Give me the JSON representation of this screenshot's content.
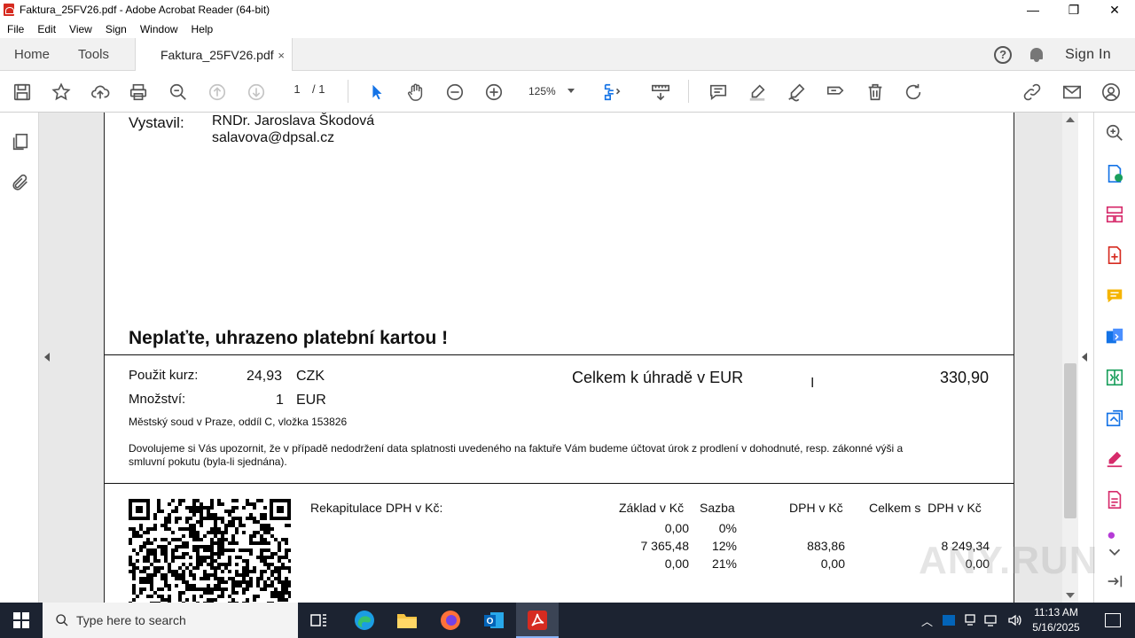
{
  "window": {
    "title": "Faktura_25FV26.pdf - Adobe Acrobat Reader (64-bit)",
    "minimize": "—",
    "maximize": "❐",
    "close": "✕"
  },
  "menu": [
    "File",
    "Edit",
    "View",
    "Sign",
    "Window",
    "Help"
  ],
  "tabs": {
    "home": "Home",
    "tools": "Tools",
    "document": "Faktura_25FV26.pdf",
    "close": "×",
    "sign_in": "Sign In"
  },
  "toolbar": {
    "page_current": "1",
    "page_total": "/ 1",
    "zoom": "125%"
  },
  "document": {
    "issuer_label": "Vystavil:",
    "issuer_name": "RNDr. Jaroslava Škodová",
    "issuer_email": "salavova@dpsal.cz",
    "paid_notice": "Neplaťte, uhrazeno platební kartou !",
    "rate_label": "Použit kurz:",
    "rate_value": "24,93",
    "rate_currency": "CZK",
    "qty_label": "Množství:",
    "qty_value": "1",
    "qty_currency": "EUR",
    "total_label": "Celkem k úhradě v EUR",
    "total_value": "330,90",
    "court": "Městský soud v Praze, oddíl C, vložka 153826",
    "notice_line1": "Dovolujeme si Vás upozornit, že v případě nedodržení data splatnosti uvedeného na faktuře Vám budeme účtovat úrok z prodlení v dohodnuté, resp. zákonné výši a",
    "notice_line2": "smluvní pokutu (byla-li sjednána).",
    "vat_title": "Rekapitulace DPH v Kč:",
    "vat_headers": [
      "Základ v Kč",
      "Sazba",
      "DPH v Kč",
      "Celkem s  DPH v Kč"
    ],
    "vat_rows": [
      [
        "0,00",
        "0%",
        "",
        ""
      ],
      [
        "7 365,48",
        "12%",
        "883,86",
        "8 249,34"
      ],
      [
        "0,00",
        "21%",
        "0,00",
        "0,00"
      ]
    ]
  },
  "taskbar": {
    "search_placeholder": "Type here to search",
    "time": "11:13 AM",
    "date": "5/16/2025"
  },
  "watermark": "ANY.RUN"
}
